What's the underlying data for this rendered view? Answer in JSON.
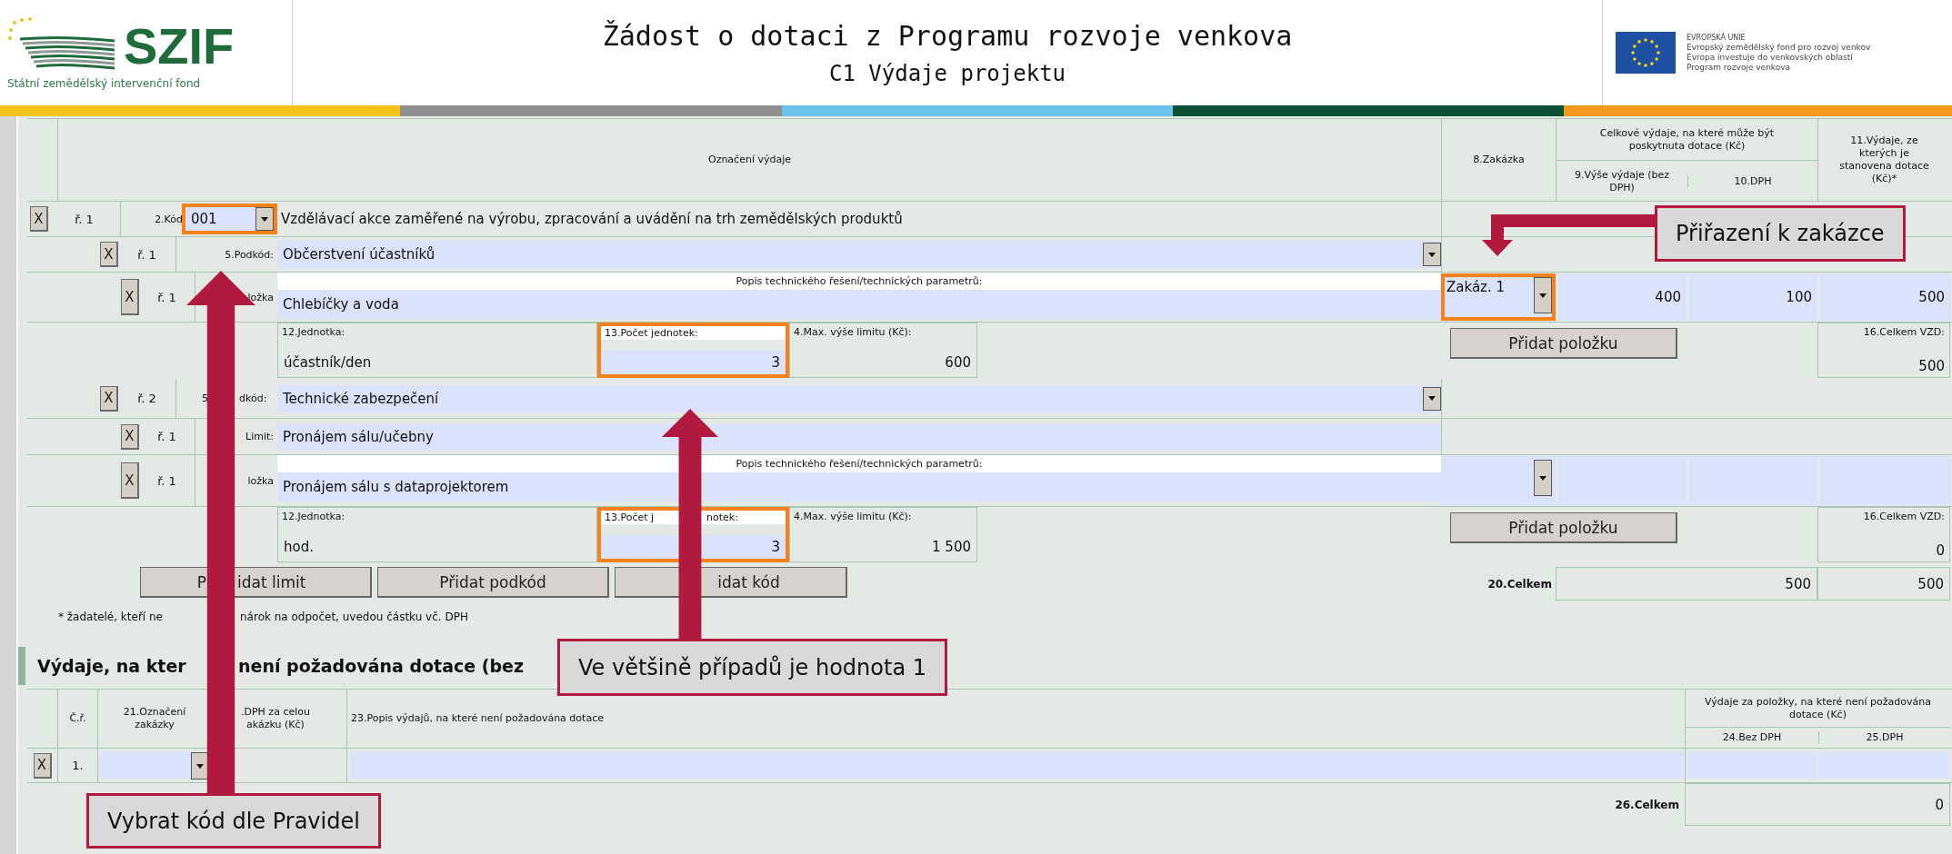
{
  "header": {
    "logo_text": "SZIF",
    "logo_caption": "Státní zemědělský intervenční fond",
    "title": "Žádost o dotaci z Programu rozvoje venkova",
    "subtitle": "C1 Výdaje projektu",
    "eu_lines": [
      "EVROPSKÁ UNIE",
      "Evropský zemědělský fond pro rozvoj venkov",
      "Evropa investuje do venkovských oblastí",
      "Program rozvoje venkova"
    ]
  },
  "expenses": {
    "columns": {
      "designation": "Označení výdaje",
      "order": "8.Zakázka",
      "eligible_group": "Celkové výdaje, na které může být poskytnuta dotace (Kč)",
      "amount": "9.Výše výdaje (bez DPH)",
      "vat": "10.DPH",
      "base": "11.Výdaje, ze kterých je stanovena dotace (Kč)*"
    },
    "rows": [
      {
        "kind": "code",
        "remove": "X",
        "row_no": "ř. 1",
        "label": "2.Kód",
        "code": "001",
        "code_highlighted": true,
        "text": "Vzdělávací akce zaměřené na výrobu, zpracování a uvádění na trh zemědělských produktů"
      },
      {
        "kind": "subcode",
        "remove": "X",
        "row_no": "ř. 1",
        "label_parts": [
          "5.Podkód:"
        ],
        "value": "Občerstvení účastníků"
      },
      {
        "kind": "item",
        "remove": "X",
        "row_no": "ř. 1",
        "label_parts": [
          "ložka"
        ],
        "description_label": "Popis technického řešení/technických parametrů:",
        "value": "Chlebíčky a voda",
        "order": "Zakáz. 1",
        "order_highlighted": true,
        "amount": "400",
        "vat": "100",
        "base": "500"
      },
      {
        "kind": "detail",
        "unit_label": "12.Jednotka:",
        "unit": "účastník/den",
        "count_label_parts": [
          "13.Počet jednotek:"
        ],
        "count": "3",
        "count_highlighted": true,
        "limit_label": "4.Max. výše limitu (Kč):",
        "limit": "600",
        "add_button": "Přidat položku",
        "sum_label": "16.Celkem VZD:",
        "sum": "500"
      },
      {
        "kind": "subcode",
        "remove": "X",
        "row_no": "ř. 2",
        "label_parts": [
          "5",
          "dkód:"
        ],
        "value": "Technické zabezpečení"
      },
      {
        "kind": "limit",
        "remove": "X",
        "row_no": "ř. 1",
        "label_parts": [
          "Limit:"
        ],
        "value": "Pronájem sálu/učebny"
      },
      {
        "kind": "item",
        "remove": "X",
        "row_no": "ř. 1",
        "label_parts": [
          "ložka"
        ],
        "description_label": "Popis technického řešení/technických parametrů:",
        "value": "Pronájem sálu s dataprojektorem",
        "order_highlighted": false
      },
      {
        "kind": "detail",
        "unit_label": "12.Jednotka:",
        "unit": "hod.",
        "count_label_parts": [
          "13.Počet j",
          "notek:"
        ],
        "count": "3",
        "count_highlighted": true,
        "limit_label": "4.Max. výše limitu (Kč):",
        "limit": "1 500",
        "add_button": "Přidat položku",
        "sum_label": "16.Celkem VZD:",
        "sum": "0"
      }
    ],
    "buttons": [
      {
        "parts": [
          "P",
          "idat limit"
        ]
      },
      {
        "parts": [
          "Přidat podkód"
        ]
      },
      {
        "parts": [
          "idat kód"
        ]
      }
    ],
    "total_label": "20.Celkem",
    "total_eligible": "500",
    "total_base": "500",
    "footnote_parts": [
      "* žadatelé, kteří ne",
      "nárok na odpočet, uvedou částku vč. DPH"
    ]
  },
  "non_subsidized": {
    "heading_parts": [
      "Výdaje, na kter",
      "není požadována dotace (bez"
    ],
    "columns": {
      "row_no": "Č.ř.",
      "order": "21.Označení zakázky",
      "vat_parts": [
        ".DPH za celou",
        "akázku (Kč)"
      ],
      "description": "23.Popis výdajů, na které není požadována dotace",
      "group": "Výdaje za položky, na které není požadována dotace (Kč)",
      "without_vat": "24.Bez DPH",
      "vat": "25.DPH"
    },
    "rows": [
      {
        "remove": "X",
        "row_no": "1."
      }
    ],
    "total_label": "26.Celkem",
    "total": "0"
  },
  "annotations": [
    {
      "kind": "elbow",
      "text": "Přiřazení k zakázce"
    },
    {
      "kind": "straight",
      "text": "Ve většině případů je hodnota 1"
    },
    {
      "kind": "straight",
      "text": "Vybrat kód dle Pravidel"
    }
  ]
}
